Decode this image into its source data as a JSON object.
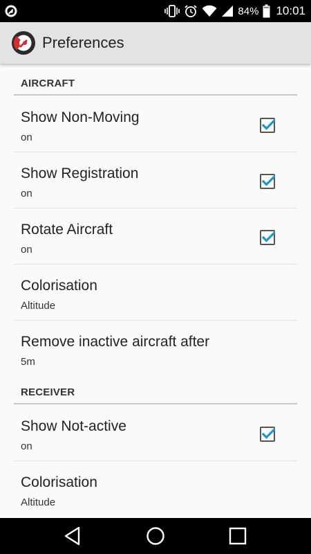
{
  "status_bar": {
    "battery_percent": "84%",
    "time": "10:01",
    "icons": [
      "notification-app-icon",
      "vibrate-icon",
      "alarm-icon",
      "wifi-icon",
      "signal-icon",
      "battery-icon"
    ]
  },
  "app_bar": {
    "title": "Preferences",
    "logo_icon": "app-logo-icon"
  },
  "sections": [
    {
      "title": "AIRCRAFT",
      "items": [
        {
          "title": "Show Non-Moving",
          "summary": "on",
          "checked": true
        },
        {
          "title": "Show Registration",
          "summary": "on",
          "checked": true
        },
        {
          "title": "Rotate Aircraft",
          "summary": "on",
          "checked": true
        },
        {
          "title": "Colorisation",
          "summary": "Altitude"
        },
        {
          "title": "Remove inactive aircraft after",
          "summary": "5m"
        }
      ]
    },
    {
      "title": "RECEIVER",
      "items": [
        {
          "title": "Show Not-active",
          "summary": "on",
          "checked": true
        },
        {
          "title": "Colorisation",
          "summary": "Altitude"
        }
      ]
    }
  ],
  "nav_bar": {
    "buttons": [
      "back-icon",
      "home-icon",
      "recents-icon"
    ]
  },
  "colors": {
    "accent": "#2196c4",
    "app_bar_bg": "#e3e3e3",
    "status_bar_bg": "#000000",
    "logo_red": "#d32f2f"
  }
}
